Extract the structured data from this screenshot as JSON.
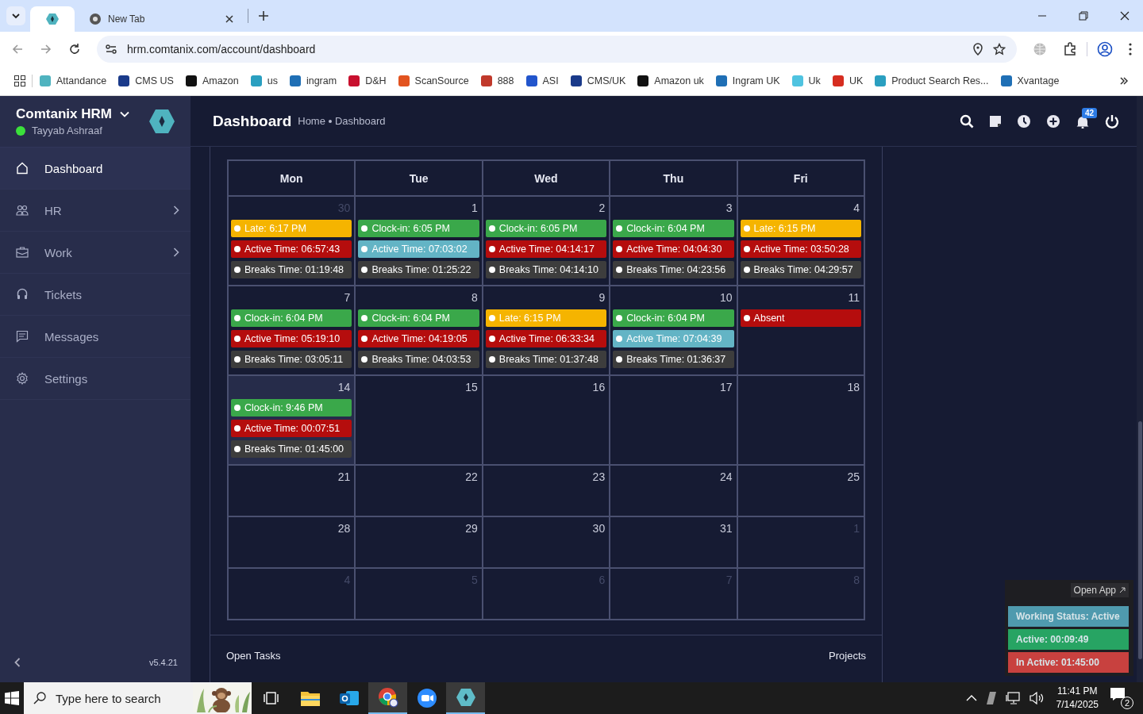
{
  "browser": {
    "tabs": [
      {
        "kind": "app",
        "selected": true
      },
      {
        "kind": "page",
        "title": "New Tab",
        "selected": false
      }
    ],
    "url": "hrm.comtanix.com/account/dashboard",
    "bookmarks": [
      {
        "label": "Attandance",
        "color": "#4fb3bf"
      },
      {
        "label": "CMS US",
        "color": "#1a3a8a"
      },
      {
        "label": "Amazon",
        "color": "#111111"
      },
      {
        "label": "us",
        "color": "#2a9fc0"
      },
      {
        "label": "ingram",
        "color": "#1f6fb5"
      },
      {
        "label": "D&H",
        "color": "#c8102e"
      },
      {
        "label": "ScanSource",
        "color": "#e2531f"
      },
      {
        "label": "888",
        "color": "#c0392b"
      },
      {
        "label": "ASI",
        "color": "#2255cc"
      },
      {
        "label": "CMS/UK",
        "color": "#1a3a8a"
      },
      {
        "label": "Amazon uk",
        "color": "#111111"
      },
      {
        "label": "Ingram UK",
        "color": "#1f6fb5"
      },
      {
        "label": "Uk",
        "color": "#4fc3e0"
      },
      {
        "label": "UK",
        "color": "#d62d20"
      },
      {
        "label": "Product Search Res...",
        "color": "#2a9fc0"
      },
      {
        "label": "Xvantage",
        "color": "#1f6fb5"
      }
    ]
  },
  "sidebar": {
    "brand": "Comtanix HRM",
    "user": "Tayyab Ashraaf",
    "online": true,
    "items": [
      {
        "label": "Dashboard",
        "kind": "home",
        "selected": true,
        "has_children": false
      },
      {
        "label": "HR",
        "kind": "users",
        "selected": false,
        "has_children": true
      },
      {
        "label": "Work",
        "kind": "briefcase",
        "selected": false,
        "has_children": true
      },
      {
        "label": "Tickets",
        "kind": "headset",
        "selected": false,
        "has_children": false
      },
      {
        "label": "Messages",
        "kind": "message",
        "selected": false,
        "has_children": false
      },
      {
        "label": "Settings",
        "kind": "gear",
        "selected": false,
        "has_children": false
      }
    ],
    "version": "v5.4.21"
  },
  "header": {
    "title": "Dashboard",
    "breadcrumb": [
      "Home",
      "Dashboard"
    ],
    "notification_count": "42"
  },
  "calendar": {
    "weekdays": [
      "Mon",
      "Tue",
      "Wed",
      "Thu",
      "Fri"
    ],
    "weeks": [
      [
        {
          "day": "30",
          "other_month": true,
          "today": false,
          "events": [
            {
              "label": "Late: 6:17 PM",
              "color": "#f5b400"
            },
            {
              "label": "Active Time: 06:57:43",
              "color": "#b50d0d"
            },
            {
              "label": "Breaks Time: 01:19:48",
              "color": "#3d3d3d"
            }
          ]
        },
        {
          "day": "1",
          "other_month": false,
          "today": false,
          "events": [
            {
              "label": "Clock-in: 6:05 PM",
              "color": "#3aa84a"
            },
            {
              "label": "Active Time: 07:03:02",
              "color": "#63b4c5"
            },
            {
              "label": "Breaks Time: 01:25:22",
              "color": "#3d3d3d"
            }
          ]
        },
        {
          "day": "2",
          "other_month": false,
          "today": false,
          "events": [
            {
              "label": "Clock-in: 6:05 PM",
              "color": "#3aa84a"
            },
            {
              "label": "Active Time: 04:14:17",
              "color": "#b50d0d"
            },
            {
              "label": "Breaks Time: 04:14:10",
              "color": "#3d3d3d"
            }
          ]
        },
        {
          "day": "3",
          "other_month": false,
          "today": false,
          "events": [
            {
              "label": "Clock-in: 6:04 PM",
              "color": "#3aa84a"
            },
            {
              "label": "Active Time: 04:04:30",
              "color": "#b50d0d"
            },
            {
              "label": "Breaks Time: 04:23:56",
              "color": "#3d3d3d"
            }
          ]
        },
        {
          "day": "4",
          "other_month": false,
          "today": false,
          "events": [
            {
              "label": "Late: 6:15 PM",
              "color": "#f5b400"
            },
            {
              "label": "Active Time: 03:50:28",
              "color": "#b50d0d"
            },
            {
              "label": "Breaks Time: 04:29:57",
              "color": "#3d3d3d"
            }
          ]
        }
      ],
      [
        {
          "day": "7",
          "other_month": false,
          "today": false,
          "events": [
            {
              "label": "Clock-in: 6:04 PM",
              "color": "#3aa84a"
            },
            {
              "label": "Active Time: 05:19:10",
              "color": "#b50d0d"
            },
            {
              "label": "Breaks Time: 03:05:11",
              "color": "#3d3d3d"
            }
          ]
        },
        {
          "day": "8",
          "other_month": false,
          "today": false,
          "events": [
            {
              "label": "Clock-in: 6:04 PM",
              "color": "#3aa84a"
            },
            {
              "label": "Active Time: 04:19:05",
              "color": "#b50d0d"
            },
            {
              "label": "Breaks Time: 04:03:53",
              "color": "#3d3d3d"
            }
          ]
        },
        {
          "day": "9",
          "other_month": false,
          "today": false,
          "events": [
            {
              "label": "Late: 6:15 PM",
              "color": "#f5b400"
            },
            {
              "label": "Active Time: 06:33:34",
              "color": "#b50d0d"
            },
            {
              "label": "Breaks Time: 01:37:48",
              "color": "#3d3d3d"
            }
          ]
        },
        {
          "day": "10",
          "other_month": false,
          "today": false,
          "events": [
            {
              "label": "Clock-in: 6:04 PM",
              "color": "#3aa84a"
            },
            {
              "label": "Active Time: 07:04:39",
              "color": "#63b4c5"
            },
            {
              "label": "Breaks Time: 01:36:37",
              "color": "#3d3d3d"
            }
          ]
        },
        {
          "day": "11",
          "other_month": false,
          "today": false,
          "events": [
            {
              "label": "Absent",
              "color": "#b50d0d"
            }
          ]
        }
      ],
      [
        {
          "day": "14",
          "other_month": false,
          "today": true,
          "events": [
            {
              "label": "Clock-in: 9:46 PM",
              "color": "#3aa84a"
            },
            {
              "label": "Active Time: 00:07:51",
              "color": "#b50d0d"
            },
            {
              "label": "Breaks Time: 01:45:00",
              "color": "#3d3d3d"
            }
          ]
        },
        {
          "day": "15",
          "other_month": false,
          "today": false
        },
        {
          "day": "16",
          "other_month": false,
          "today": false
        },
        {
          "day": "17",
          "other_month": false,
          "today": false
        },
        {
          "day": "18",
          "other_month": false,
          "today": false
        }
      ],
      [
        {
          "day": "21",
          "other_month": false,
          "today": false
        },
        {
          "day": "22",
          "other_month": false,
          "today": false
        },
        {
          "day": "23",
          "other_month": false,
          "today": false
        },
        {
          "day": "24",
          "other_month": false,
          "today": false
        },
        {
          "day": "25",
          "other_month": false,
          "today": false
        }
      ],
      [
        {
          "day": "28",
          "other_month": false,
          "today": false
        },
        {
          "day": "29",
          "other_month": false,
          "today": false
        },
        {
          "day": "30",
          "other_month": false,
          "today": false
        },
        {
          "day": "31",
          "other_month": false,
          "today": false
        },
        {
          "day": "1",
          "other_month": true,
          "today": false
        }
      ],
      [
        {
          "day": "4",
          "other_month": true,
          "today": false
        },
        {
          "day": "5",
          "other_month": true,
          "today": false
        },
        {
          "day": "6",
          "other_month": true,
          "today": false
        },
        {
          "day": "7",
          "other_month": true,
          "today": false
        },
        {
          "day": "8",
          "other_month": true,
          "today": false
        }
      ]
    ]
  },
  "sections": {
    "left": "Open Tasks",
    "right": "Projects"
  },
  "tracker": {
    "open_app": "Open App",
    "status": "Working Status: Active",
    "active": "Active: 00:09:49",
    "inactive": "In Active: 01:45:00"
  },
  "taskbar": {
    "search_placeholder": "Type here to search",
    "apps": [
      {
        "kind": "taskview",
        "selected": false
      },
      {
        "kind": "folder",
        "selected": false
      },
      {
        "kind": "mail",
        "selected": false
      },
      {
        "kind": "chrome",
        "selected": true
      },
      {
        "kind": "zoom",
        "selected": false
      },
      {
        "kind": "hrm",
        "selected": true
      }
    ],
    "time": "11:41 PM",
    "date": "7/14/2025",
    "notifications": "2"
  }
}
